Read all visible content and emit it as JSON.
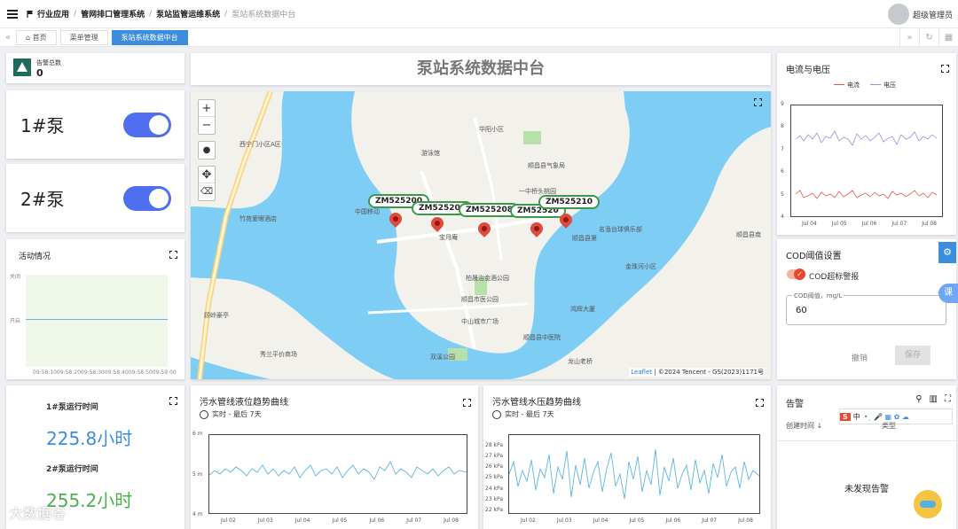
{
  "header": {
    "breadcrumb": [
      "行业应用",
      "管网排口管理系统",
      "泵站监管运维系统",
      "泵站系统数据中台"
    ],
    "user": "超级管理员"
  },
  "tabs": [
    "首页",
    "菜单管理",
    "泵站系统数据中台"
  ],
  "alarm_count": {
    "label": "告警总数",
    "value": "0"
  },
  "pumps": [
    {
      "label": "1#泵",
      "on": true
    },
    {
      "label": "2#泵",
      "on": true
    }
  ],
  "activity": {
    "title": "活动情况",
    "ylabels": [
      "关闭",
      "开启"
    ],
    "xlabels": [
      "09:58:10",
      "09:58:20",
      "09:58:30",
      "09:58:40",
      "09:58:50",
      "09:59:00"
    ]
  },
  "page_title": "泵站系统数据中台",
  "map": {
    "stations": [
      "ZM525200",
      "ZM525209",
      "ZM525208",
      "ZM52520",
      "ZM525210"
    ],
    "attribution_link": "Leaflet",
    "attribution": "| ©2024 Tencent - GS(2023)1171号",
    "places": [
      "西宁门小区A区",
      "游泳馆",
      "顺昌县气象局",
      "一中桥头桃园",
      "竹苑爱眼酒店",
      "中国移动",
      "宝月庵",
      "柏晟治金酒公园",
      "顺昌县第",
      "名渔台球俱乐部",
      "顺昌县南",
      "鸿辉大厦",
      "中山城市广场",
      "顺昌县中医院",
      "双溪公园",
      "顺昌市医公园",
      "龙山老桥",
      "秀兰平价商场",
      "顾岭豪亭",
      "金珠河小区",
      "华阳小区"
    ]
  },
  "current_voltage": {
    "title": "电流与电压",
    "legend": [
      "电流",
      "电压"
    ],
    "colors": [
      "#e05a47",
      "#9a8ee0"
    ],
    "yticks": [
      "9",
      "8",
      "7",
      "6",
      "5",
      "4"
    ],
    "xticks": [
      "Jul 04",
      "Jul 05",
      "Jul 06",
      "Jul 07",
      "Jul 08"
    ]
  },
  "cod": {
    "title": "COD阈值设置",
    "toggle_label": "COD超标警报",
    "field_label": "COD阈值，mg/L",
    "field_value": "60",
    "cancel": "撤销",
    "save": "保存"
  },
  "runtime": {
    "pump1_label": "1#泵运行时间",
    "pump1_value": "225.8小时",
    "pump2_label": "2#泵运行时间",
    "pump2_value": "255.2小时"
  },
  "level_chart": {
    "title": "污水管线液位趋势曲线",
    "subtitle": "实时 - 最后 7天",
    "yticks": [
      "6 m",
      "5 m",
      "4 m"
    ],
    "xticks": [
      "Jul 02",
      "Jul 03",
      "Jul 04",
      "Jul 05",
      "Jul 06",
      "Jul 07",
      "Jul 08"
    ]
  },
  "pressure_chart": {
    "title": "污水管线水压趋势曲线",
    "subtitle": "实时 - 最后 7天",
    "yticks": [
      "28 kPa",
      "27 kPa",
      "26 kPa",
      "25 kPa",
      "24 kPa",
      "23 kPa",
      "22 kPa"
    ],
    "xticks": [
      "Jul 02",
      "Jul 03",
      "Jul 04",
      "Jul 05",
      "Jul 06",
      "Jul 07",
      "Jul 08"
    ]
  },
  "alarms": {
    "title": "告警",
    "col_time": "创建时间",
    "col_type": "类型",
    "empty": "未发现告警"
  },
  "watermark": "大数据谷",
  "side_badge": "课"
}
